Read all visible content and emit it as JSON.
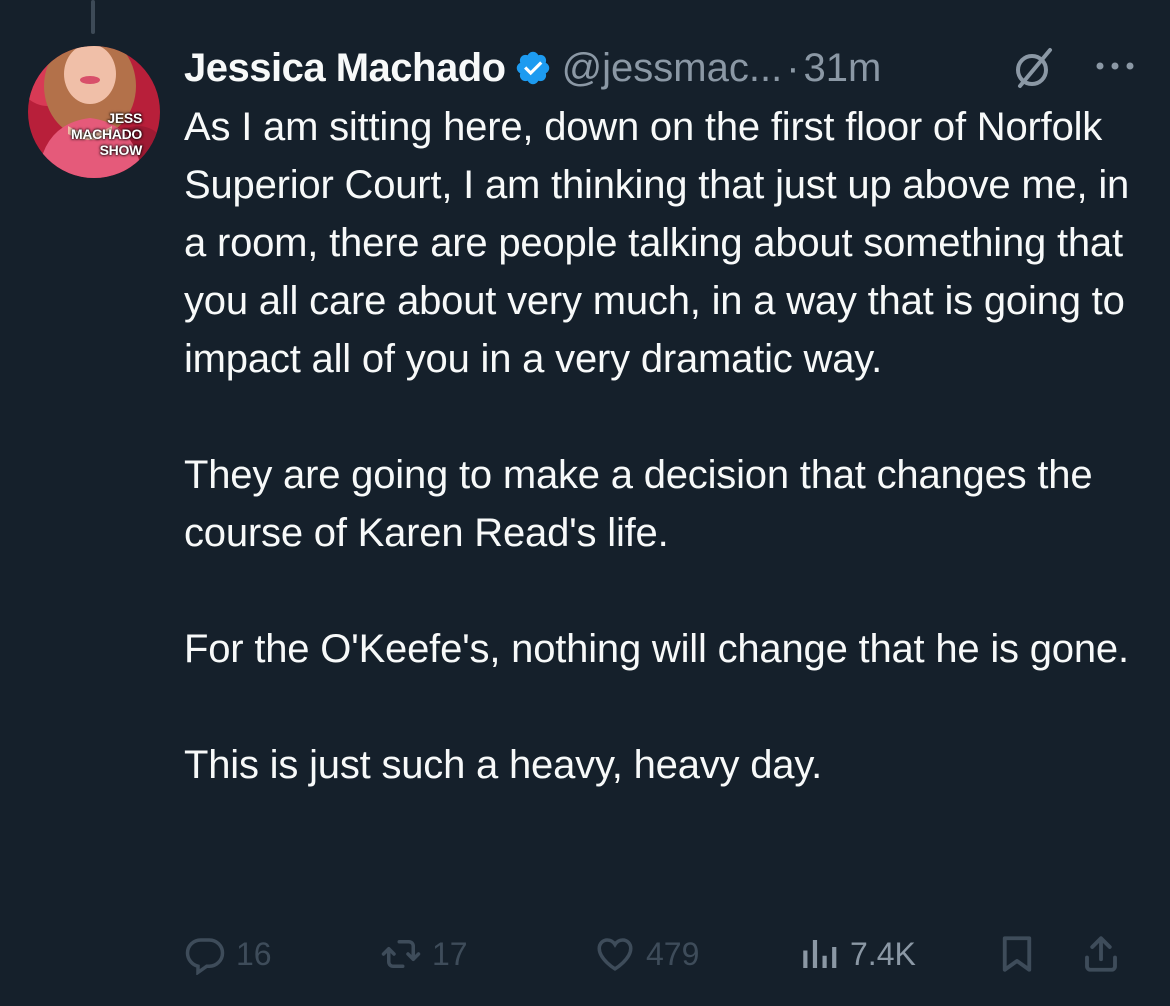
{
  "author": {
    "name": "Jessica Machado",
    "handle": "@jessmac...",
    "separator": "·",
    "time": "31m",
    "avatar_text": [
      "JESS",
      "MACHADO",
      "SHOW"
    ]
  },
  "tweet": {
    "paragraphs": [
      "As I am sitting here, down on the first floor of Norfolk Superior Court, I am thinking that just up above me, in a room, there are people talking about something that you all care about very much, in a way that is going to impact all of you in a very dramatic way.",
      "They are going to make a decision that changes the course of Karen Read's life.",
      "For the O'Keefe's, nothing will change that he is gone.",
      "This is just such a heavy, heavy day."
    ]
  },
  "actions": {
    "replies": "16",
    "reposts": "17",
    "likes": "479",
    "views": "7.4K"
  },
  "icons": {
    "verified": "verified-badge-icon",
    "grok": "grok-icon",
    "more": "more-icon",
    "reply": "reply-icon",
    "repost": "repost-icon",
    "like": "heart-icon",
    "views": "views-icon",
    "bookmark": "bookmark-icon",
    "share": "share-icon"
  },
  "colors": {
    "background": "#15202b",
    "text": "#f7f9f9",
    "secondary": "#8b98a5",
    "verified": "#1d9bf0",
    "avatar_bg": "#c9253f"
  }
}
